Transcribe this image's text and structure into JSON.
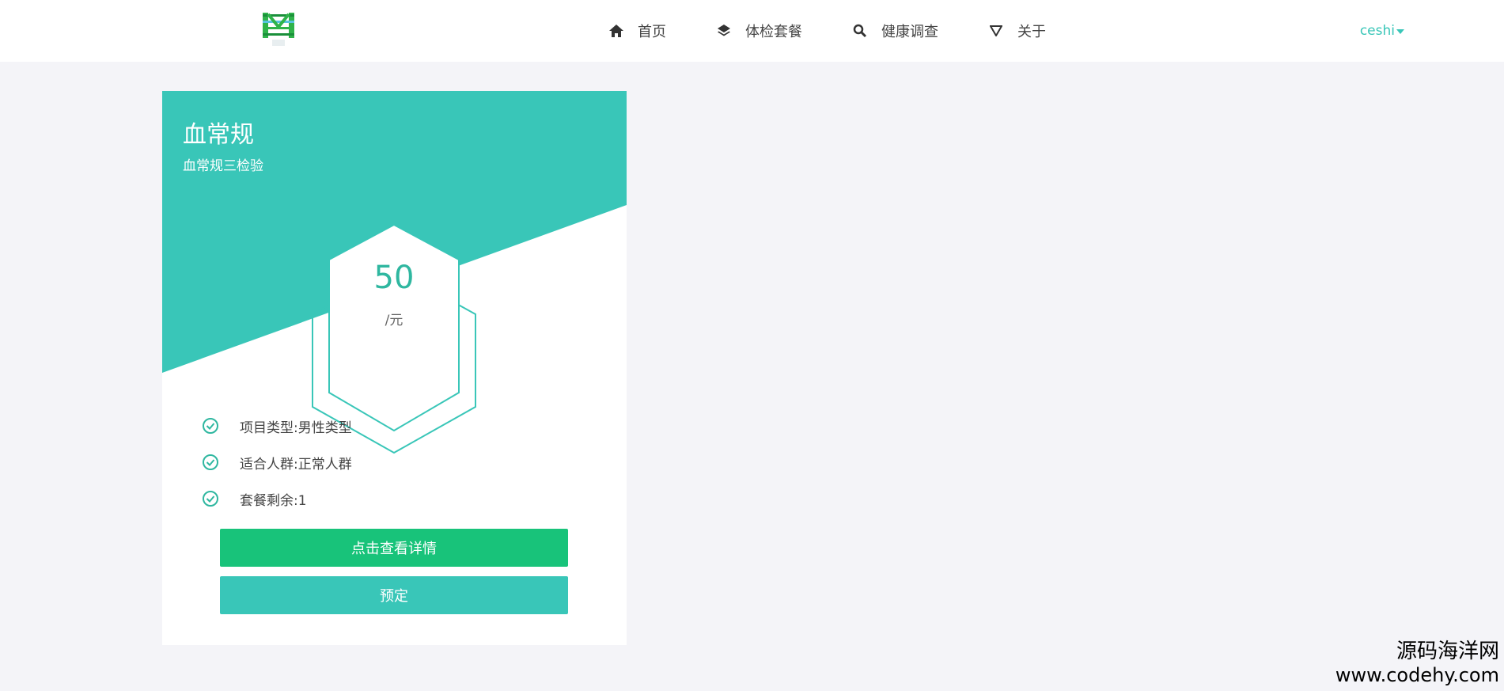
{
  "header": {
    "nav": [
      {
        "label": "首页",
        "icon": "home-icon"
      },
      {
        "label": "体检套餐",
        "icon": "layers-icon"
      },
      {
        "label": "健康调查",
        "icon": "search-icon"
      },
      {
        "label": "关于",
        "icon": "triangle-down-icon"
      }
    ],
    "user": "ceshi"
  },
  "card": {
    "title": "血常规",
    "subtitle": "血常规三检验",
    "price": "50",
    "unit": "/元",
    "features": [
      "项目类型:男性类型",
      "适合人群:正常人群",
      "套餐剩余:1"
    ],
    "detail_button": "点击查看详情",
    "book_button": "预定"
  },
  "watermark": {
    "line1": "源码海洋网",
    "line2": "www.codehy.com"
  },
  "colors": {
    "teal": "#39c6b8",
    "green": "#18c37a",
    "page_bg": "#f4f4f8"
  }
}
